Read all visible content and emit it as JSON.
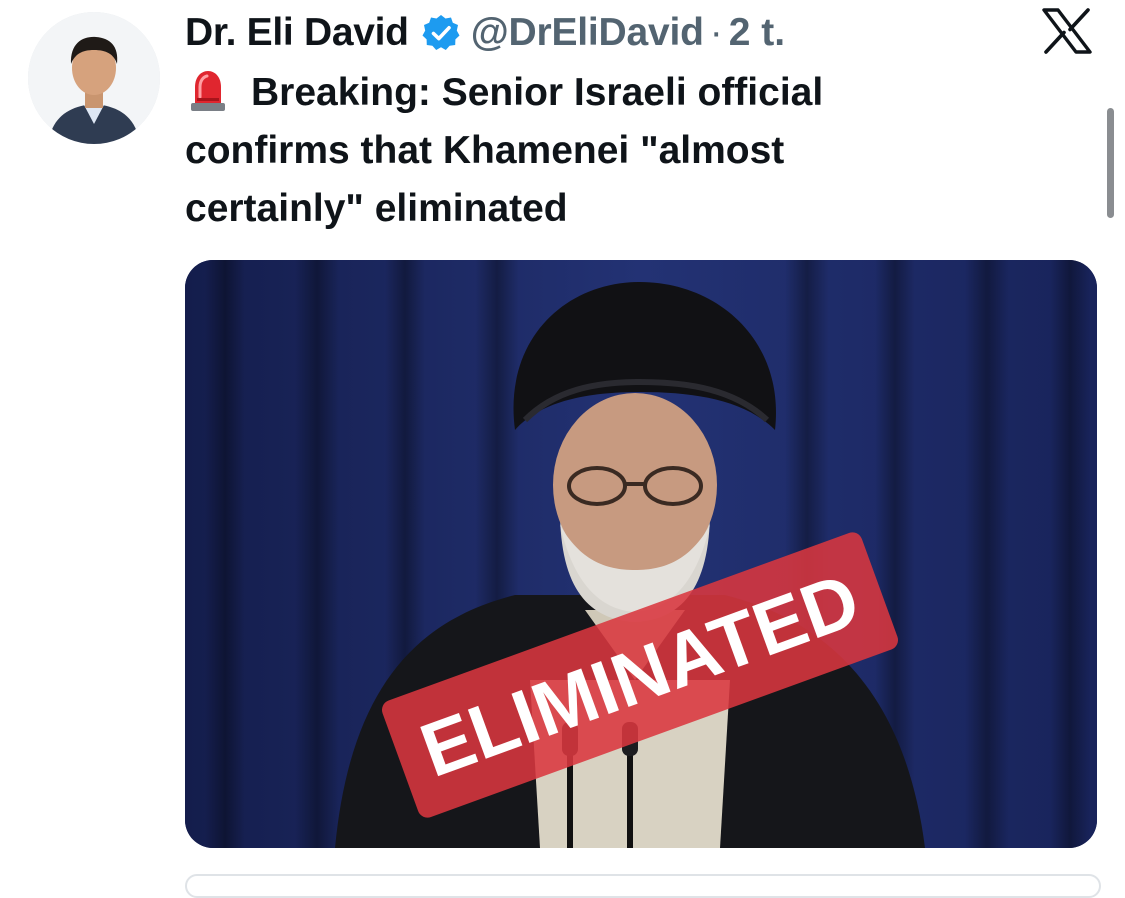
{
  "author": {
    "name": "Dr. Eli David",
    "handle": "@DrEliDavid",
    "separator": "·",
    "time": "2 t.",
    "verified": true,
    "avatar_icon": "profile-photo"
  },
  "app_logo_icon": "x-logo-icon",
  "tweet": {
    "emoji_icon": "police-siren-icon",
    "text": "Breaking: Senior Israeli official confirms that Khamenei \"almost certainly\" eliminated"
  },
  "media": {
    "stamp_text": "ELIMINATED",
    "stamp_color": "#d9373f"
  },
  "colors": {
    "text_primary": "#0f1419",
    "text_secondary": "#536471",
    "verified_blue": "#1d9bf0",
    "curtain_blue": "#1d2a63"
  }
}
